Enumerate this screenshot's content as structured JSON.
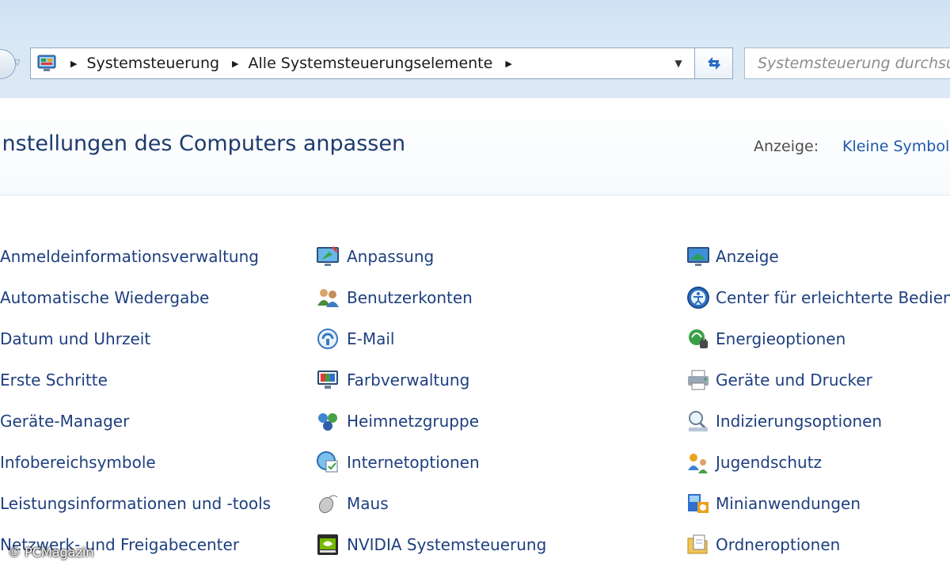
{
  "address_bar": {
    "breadcrumbs": [
      "Systemsteuerung",
      "Alle Systemsteuerungselemente"
    ],
    "search_placeholder": "Systemsteuerung durchsuchen"
  },
  "header": {
    "title": "Einstellungen des Computers anpassen",
    "view_label": "Anzeige:",
    "view_value": "Kleine Symbole"
  },
  "columns": [
    {
      "items": [
        {
          "label": "Anmeldeinformationsverwaltung",
          "icon": "credential-icon"
        },
        {
          "label": "Automatische Wiedergabe",
          "icon": "autoplay-icon"
        },
        {
          "label": "Datum und Uhrzeit",
          "icon": "clock-icon"
        },
        {
          "label": "Erste Schritte",
          "icon": "getting-started-icon"
        },
        {
          "label": "Geräte-Manager",
          "icon": "device-manager-icon"
        },
        {
          "label": "Infobereichsymbole",
          "icon": "notification-icon"
        },
        {
          "label": "Leistungsinformationen und -tools",
          "icon": "performance-icon"
        },
        {
          "label": "Netzwerk- und Freigabecenter",
          "icon": "network-icon"
        }
      ]
    },
    {
      "items": [
        {
          "label": "Anpassung",
          "icon": "personalization-icon"
        },
        {
          "label": "Benutzerkonten",
          "icon": "user-accounts-icon"
        },
        {
          "label": "E-Mail",
          "icon": "mail-icon"
        },
        {
          "label": "Farbverwaltung",
          "icon": "color-management-icon"
        },
        {
          "label": "Heimnetzgruppe",
          "icon": "homegroup-icon"
        },
        {
          "label": "Internetoptionen",
          "icon": "internet-options-icon"
        },
        {
          "label": "Maus",
          "icon": "mouse-icon"
        },
        {
          "label": "NVIDIA Systemsteuerung",
          "icon": "nvidia-icon"
        }
      ]
    },
    {
      "items": [
        {
          "label": "Anzeige",
          "icon": "display-icon"
        },
        {
          "label": "Center für erleichterte Bedienung",
          "icon": "ease-of-access-icon"
        },
        {
          "label": "Energieoptionen",
          "icon": "power-options-icon"
        },
        {
          "label": "Geräte und Drucker",
          "icon": "printer-icon"
        },
        {
          "label": "Indizierungsoptionen",
          "icon": "indexing-icon"
        },
        {
          "label": "Jugendschutz",
          "icon": "parental-controls-icon"
        },
        {
          "label": "Minianwendungen",
          "icon": "gadgets-icon"
        },
        {
          "label": "Ordneroptionen",
          "icon": "folder-options-icon"
        }
      ]
    }
  ],
  "watermark": "© PCMagazin"
}
